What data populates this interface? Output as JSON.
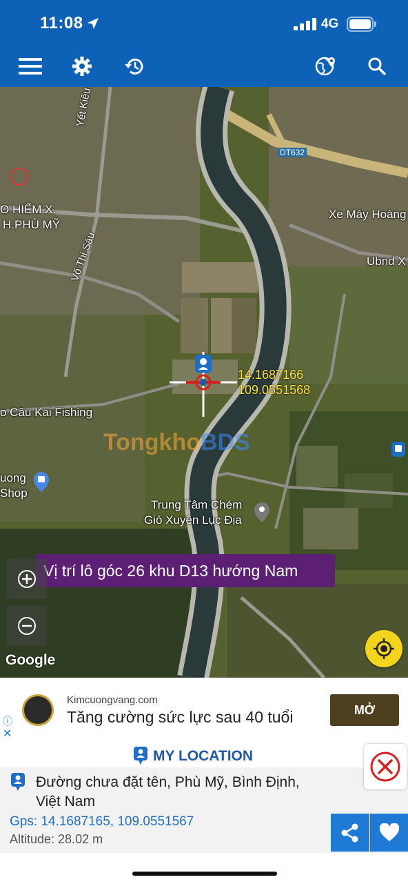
{
  "status_bar": {
    "time": "11:08",
    "network": "4G"
  },
  "toolbar": {
    "menu_icon": "hamburger-icon",
    "settings_icon": "gear-icon",
    "history_icon": "history-icon",
    "globe_icon": "globe-pin-icon",
    "search_icon": "search-icon",
    "bar_color": "#0d62b8"
  },
  "map": {
    "labels": {
      "yet_kieu": "Yết Kiêu",
      "bao_hiem_1": "O HIỂM X.",
      "bao_hiem_2": "H.PHÙ MỸ",
      "vo_thi_sau": "Võ Thị Sáu",
      "dt632": "DT632",
      "xe_may": "Xe Máy Hoàng",
      "ubnd": "Ubnd X",
      "fishing": "o Câu Kai Fishing",
      "shop_1": "uong",
      "shop_2": "Shop",
      "trung_tam_1": "Trung Tâm Chém",
      "trung_tam_2": "Gió Xuyên Lục Địa"
    },
    "coords": {
      "lat": "14.1687166",
      "lng": "109.0551568"
    },
    "watermark": {
      "part1": "Tongkho",
      "part2": "BDS"
    },
    "banner": "Vị trí lô góc 26 khu D13 hướng Nam",
    "attribution": "Google",
    "zoom_in_icon": "plus-icon",
    "zoom_out_icon": "minus-icon",
    "locate_icon": "crosshair-icon"
  },
  "ad": {
    "domain": "Kimcuongvang.com",
    "title": "Tăng cường sức lực sau 40 tuổi",
    "button": "MỞ",
    "info_icon": "ⓘ",
    "close_icon": "✕"
  },
  "location": {
    "heading": "MY LOCATION",
    "address_line1": "Đường chưa đặt tên, Phù Mỹ, Bình Định,",
    "address_line2": "Việt Nam",
    "gps": "Gps: 14.1687165, 109.0551567",
    "altitude": "Altitude: 28.02 m"
  }
}
